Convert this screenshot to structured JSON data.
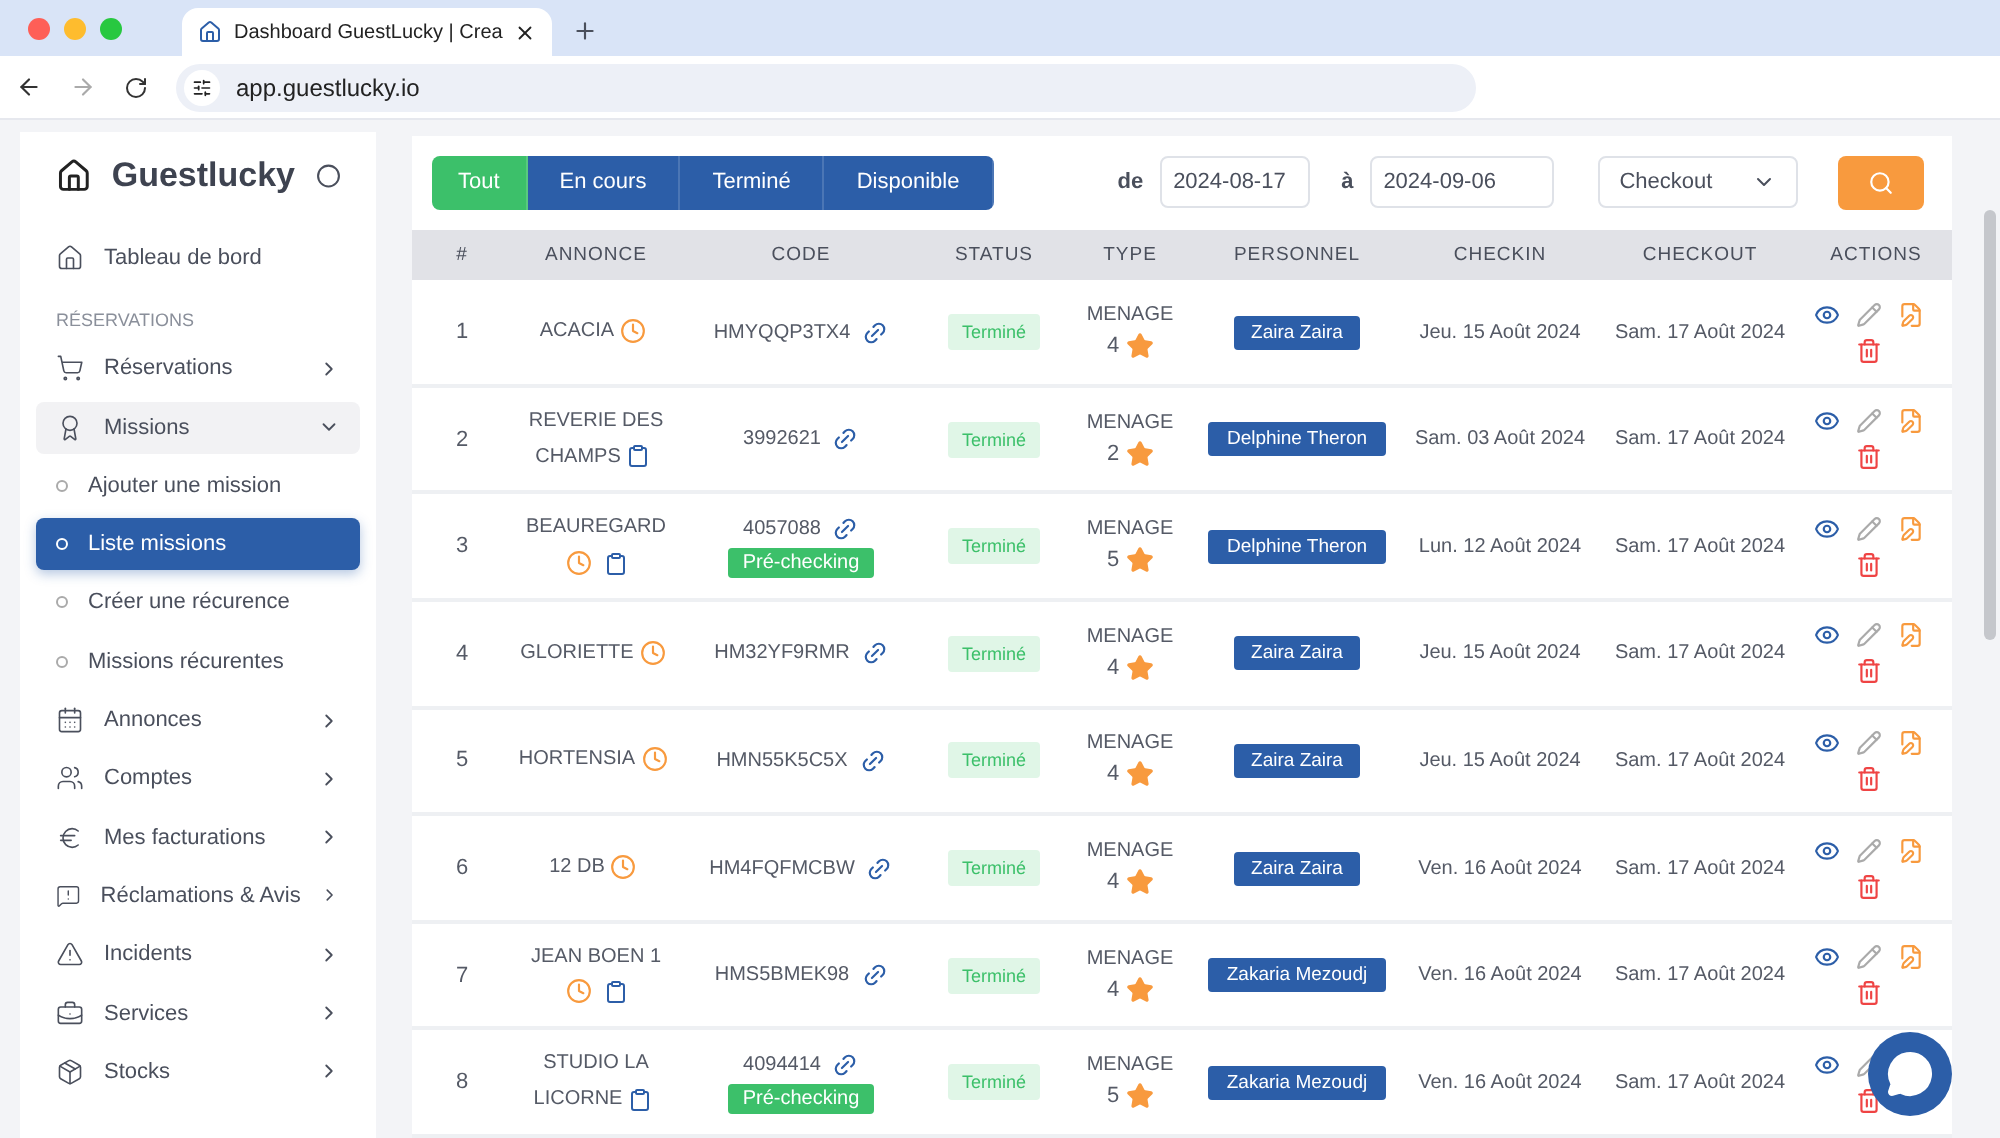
{
  "browser": {
    "tab_title": "Dashboard GuestLucky | Crea",
    "url": "app.guestlucky.io"
  },
  "sidebar": {
    "brand": "Guestlucky",
    "items": [
      {
        "kind": "item",
        "label": "Tableau de bord"
      },
      {
        "kind": "section",
        "label": "RÉSERVATIONS"
      },
      {
        "kind": "item",
        "label": "Réservations",
        "expanded": false
      },
      {
        "kind": "item",
        "label": "Missions",
        "expanded": true,
        "children": [
          {
            "label": "Ajouter une mission",
            "selected": false
          },
          {
            "label": "Liste missions",
            "selected": true
          },
          {
            "label": "Créer une récurence",
            "selected": false
          },
          {
            "label": "Missions récurentes",
            "selected": false
          }
        ]
      },
      {
        "kind": "item",
        "label": "Annonces",
        "expanded": false
      },
      {
        "kind": "item",
        "label": "Comptes",
        "expanded": false
      },
      {
        "kind": "item",
        "label": "Mes facturations",
        "expanded": false
      },
      {
        "kind": "item",
        "label": "Réclamations & Avis",
        "expanded": false
      },
      {
        "kind": "item",
        "label": "Incidents",
        "expanded": false
      },
      {
        "kind": "item",
        "label": "Services",
        "expanded": false
      },
      {
        "kind": "item",
        "label": "Stocks",
        "expanded": false
      }
    ]
  },
  "filters": {
    "tabs": [
      {
        "label": "Tout",
        "selected": true
      },
      {
        "label": "En cours",
        "selected": false
      },
      {
        "label": "Terminé",
        "selected": false
      },
      {
        "label": "Disponible",
        "selected": false
      }
    ],
    "from_label": "de",
    "from": "2024-08-17",
    "to_label": "à",
    "to": "2024-09-06",
    "date_type": "Checkout"
  },
  "table": {
    "columns": [
      "#",
      "ANNONCE",
      "CODE",
      "STATUS",
      "TYPE",
      "PERSONNEL",
      "CHECKIN",
      "CHECKOUT",
      "ACTIONS"
    ],
    "rows": [
      {
        "num": "1",
        "annonce": "ACACIA",
        "clock": true,
        "clipboard": false,
        "code": "HMYQQP3TX4",
        "status": "Terminé",
        "type": "MENAGE",
        "rating": "4",
        "personnel": "Zaira Zaira",
        "checkin": "Jeu. 15 Août 2024",
        "checkout": "Sam. 17 Août 2024"
      },
      {
        "num": "2",
        "annonce": "REVERIE DES CHAMPS",
        "clock": false,
        "clipboard": true,
        "code": "3992621",
        "status": "Terminé",
        "type": "MENAGE",
        "rating": "2",
        "personnel": "Delphine Theron",
        "checkin": "Sam. 03 Août 2024",
        "checkout": "Sam. 17 Août 2024"
      },
      {
        "num": "3",
        "annonce": "BEAUREGARD",
        "clock": true,
        "clipboard": true,
        "code": "4057088",
        "precheck": "Pré-checking",
        "status": "Terminé",
        "type": "MENAGE",
        "rating": "5",
        "personnel": "Delphine Theron",
        "checkin": "Lun. 12 Août 2024",
        "checkout": "Sam. 17 Août 2024"
      },
      {
        "num": "4",
        "annonce": "GLORIETTE",
        "clock": true,
        "clipboard": false,
        "code": "HM32YF9RMR",
        "status": "Terminé",
        "type": "MENAGE",
        "rating": "4",
        "personnel": "Zaira Zaira",
        "checkin": "Jeu. 15 Août 2024",
        "checkout": "Sam. 17 Août 2024"
      },
      {
        "num": "5",
        "annonce": "HORTENSIA",
        "clock": true,
        "clipboard": false,
        "code": "HMN55K5C5X",
        "status": "Terminé",
        "type": "MENAGE",
        "rating": "4",
        "personnel": "Zaira Zaira",
        "checkin": "Jeu. 15 Août 2024",
        "checkout": "Sam. 17 Août 2024"
      },
      {
        "num": "6",
        "annonce": "12 DB",
        "clock": true,
        "clipboard": false,
        "code": "HM4FQFMCBW",
        "status": "Terminé",
        "type": "MENAGE",
        "rating": "4",
        "personnel": "Zaira Zaira",
        "checkin": "Ven. 16 Août 2024",
        "checkout": "Sam. 17 Août 2024"
      },
      {
        "num": "7",
        "annonce": "JEAN BOEN 1",
        "clock": true,
        "clipboard": true,
        "code": "HMS5BMEK98",
        "status": "Terminé",
        "type": "MENAGE",
        "rating": "4",
        "personnel": "Zakaria Mezoudj",
        "checkin": "Ven. 16 Août 2024",
        "checkout": "Sam. 17 Août 2024"
      },
      {
        "num": "8",
        "annonce": "STUDIO LA LICORNE",
        "clock": false,
        "clipboard": true,
        "code": "4094414",
        "precheck": "Pré-checking",
        "status": "Terminé",
        "type": "MENAGE",
        "rating": "5",
        "personnel": "Zakaria Mezoudj",
        "checkin": "Ven. 16 Août 2024",
        "checkout": "Sam. 17 Août 2024"
      }
    ]
  }
}
